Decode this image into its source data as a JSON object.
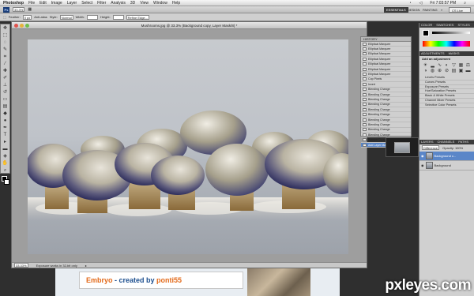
{
  "menubar": {
    "items": [
      "Photoshop",
      "File",
      "Edit",
      "Image",
      "Layer",
      "Select",
      "Filter",
      "Analysis",
      "3D",
      "View",
      "Window",
      "Help"
    ],
    "clock": "Fri 7:03:57 PM"
  },
  "appbar": {
    "badge": "Ps",
    "zoom": "33.3%",
    "workspaces": [
      "ESSENTIALS",
      "DESIGN",
      "PAINTING",
      "»"
    ],
    "search_placeholder": "CS Live"
  },
  "options": {
    "feather_label": "Feather:",
    "feather_value": "0 px",
    "antialias_label": "Anti-alias",
    "style_label": "Style:",
    "style_value": "Normal",
    "width_label": "Width:",
    "height_label": "Height:",
    "refine_label": "Refine Edge..."
  },
  "document": {
    "title": "Mushrooms.jpg @ 33.3% (Background copy, Layer Mask/8) *",
    "zoom": "33.33%",
    "status": "Exposure works in 32-bit only"
  },
  "history": {
    "title": "HISTORY",
    "items": [
      "Elliptical Marquee",
      "Elliptical Marquee",
      "Elliptical Marquee",
      "Elliptical Marquee",
      "Elliptical Marquee",
      "Elliptical Marquee",
      "Elliptical Marquee",
      "Cop Pixels",
      "Invert",
      "Blending Change",
      "Blending Change",
      "Blending Change",
      "Blending Change",
      "Blending Change",
      "Blending Change",
      "Blending Change",
      "Blending Change",
      "Blending Change",
      "Blending Change",
      "Blender Opacity Change",
      "Add Layer Mask"
    ]
  },
  "color_panel": {
    "tabs": [
      "COLOR",
      "SWATCHES",
      "STYLES"
    ]
  },
  "adjustments": {
    "tabs": [
      "ADJUSTMENTS",
      "MASKS"
    ],
    "subtitle": "Add an adjustment",
    "presets": [
      "Levels Presets",
      "Curves Presets",
      "Exposure Presets",
      "Hue/Saturation Presets",
      "Black & White Presets",
      "Channel Mixer Presets",
      "Selective Color Presets"
    ]
  },
  "layers": {
    "tabs": [
      "LAYERS",
      "CHANNELS",
      "PATHS"
    ],
    "blend_mode": "Difference",
    "opacity": "Opacity: 100%",
    "items": [
      {
        "name": "Background c...",
        "selected": true
      },
      {
        "name": "Background",
        "selected": false
      }
    ]
  },
  "background_page": {
    "title_prefix": "Embryo",
    "title_mid": " - created by ",
    "author": "ponti55"
  },
  "watermark": "pxleyes.com",
  "colors": {
    "accent": "#5a86c8",
    "orange": "#e36a1a",
    "navy": "#1d4f8f"
  }
}
